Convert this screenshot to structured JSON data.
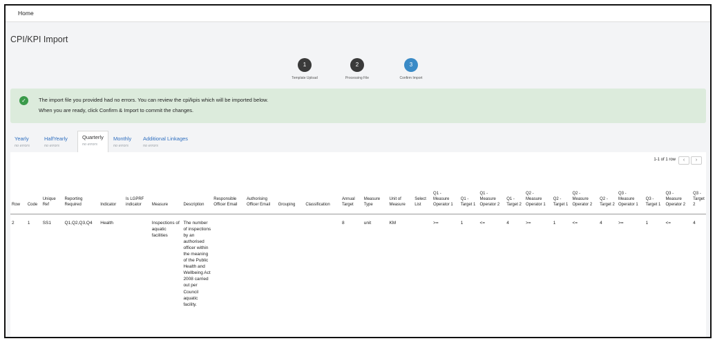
{
  "nav": {
    "home": "Home"
  },
  "page": {
    "title": "CPI/KPI Import"
  },
  "steps": [
    {
      "number": "1",
      "label": "Template Upload"
    },
    {
      "number": "2",
      "label": "Processing File"
    },
    {
      "number": "3",
      "label": "Confirm Import"
    }
  ],
  "alert": {
    "line1": "The import file you provided had no errors. You can review the cpi/kpis which will be imported below.",
    "line2": "When you are ready, click Confirm & Import to commit the changes."
  },
  "tabs": [
    {
      "label": "Yearly",
      "status": "no errors"
    },
    {
      "label": "HalfYearly",
      "status": "no errors"
    },
    {
      "label": "Quarterly",
      "status": "no errors"
    },
    {
      "label": "Monthly",
      "status": "no errors"
    },
    {
      "label": "Additional Linkages",
      "status": "no errors"
    }
  ],
  "pager": {
    "text": "1-1 of 1 row",
    "prev": "‹",
    "next": "›"
  },
  "table": {
    "columns": [
      "Row",
      "Code",
      "Unique Ref",
      "Reporting Required",
      "Indicator",
      "Is LGPRF indicator",
      "Measure",
      "Description",
      "Responsible Officer Email",
      "Authorising Officer Email",
      "Grouping",
      "Classification",
      "Annual Target",
      "Measure Type",
      "Unit of Measure",
      "Select List",
      "Q1 - Measure Operator 1",
      "Q1 - Target 1",
      "Q1 - Measure Operator 2",
      "Q1 - Target 2",
      "Q2 - Measure Operator 1",
      "Q2 - Target 1",
      "Q2 - Measure Operator 2",
      "Q2 - Target 2",
      "Q3 - Measure Operator 1",
      "Q3 - Target 1",
      "Q3 - Measure Operator 2",
      "Q3 - Target 2"
    ],
    "rows": [
      [
        "2",
        "1",
        "SS1",
        "Q1,Q2,Q3,Q4",
        "Health",
        "",
        "Inspections of aquatic facilities",
        "The number of inspections by an authorised officer within the meaning of the Public Health and Wellbeing Act 2008 carried out per Council aquatic facility.",
        "",
        "",
        "",
        "",
        "8",
        "unit",
        "KM",
        "",
        ">=",
        "1",
        "<=",
        "4",
        ">=",
        "1",
        "<=",
        "4",
        ">=",
        "1",
        "<=",
        "4"
      ]
    ]
  }
}
